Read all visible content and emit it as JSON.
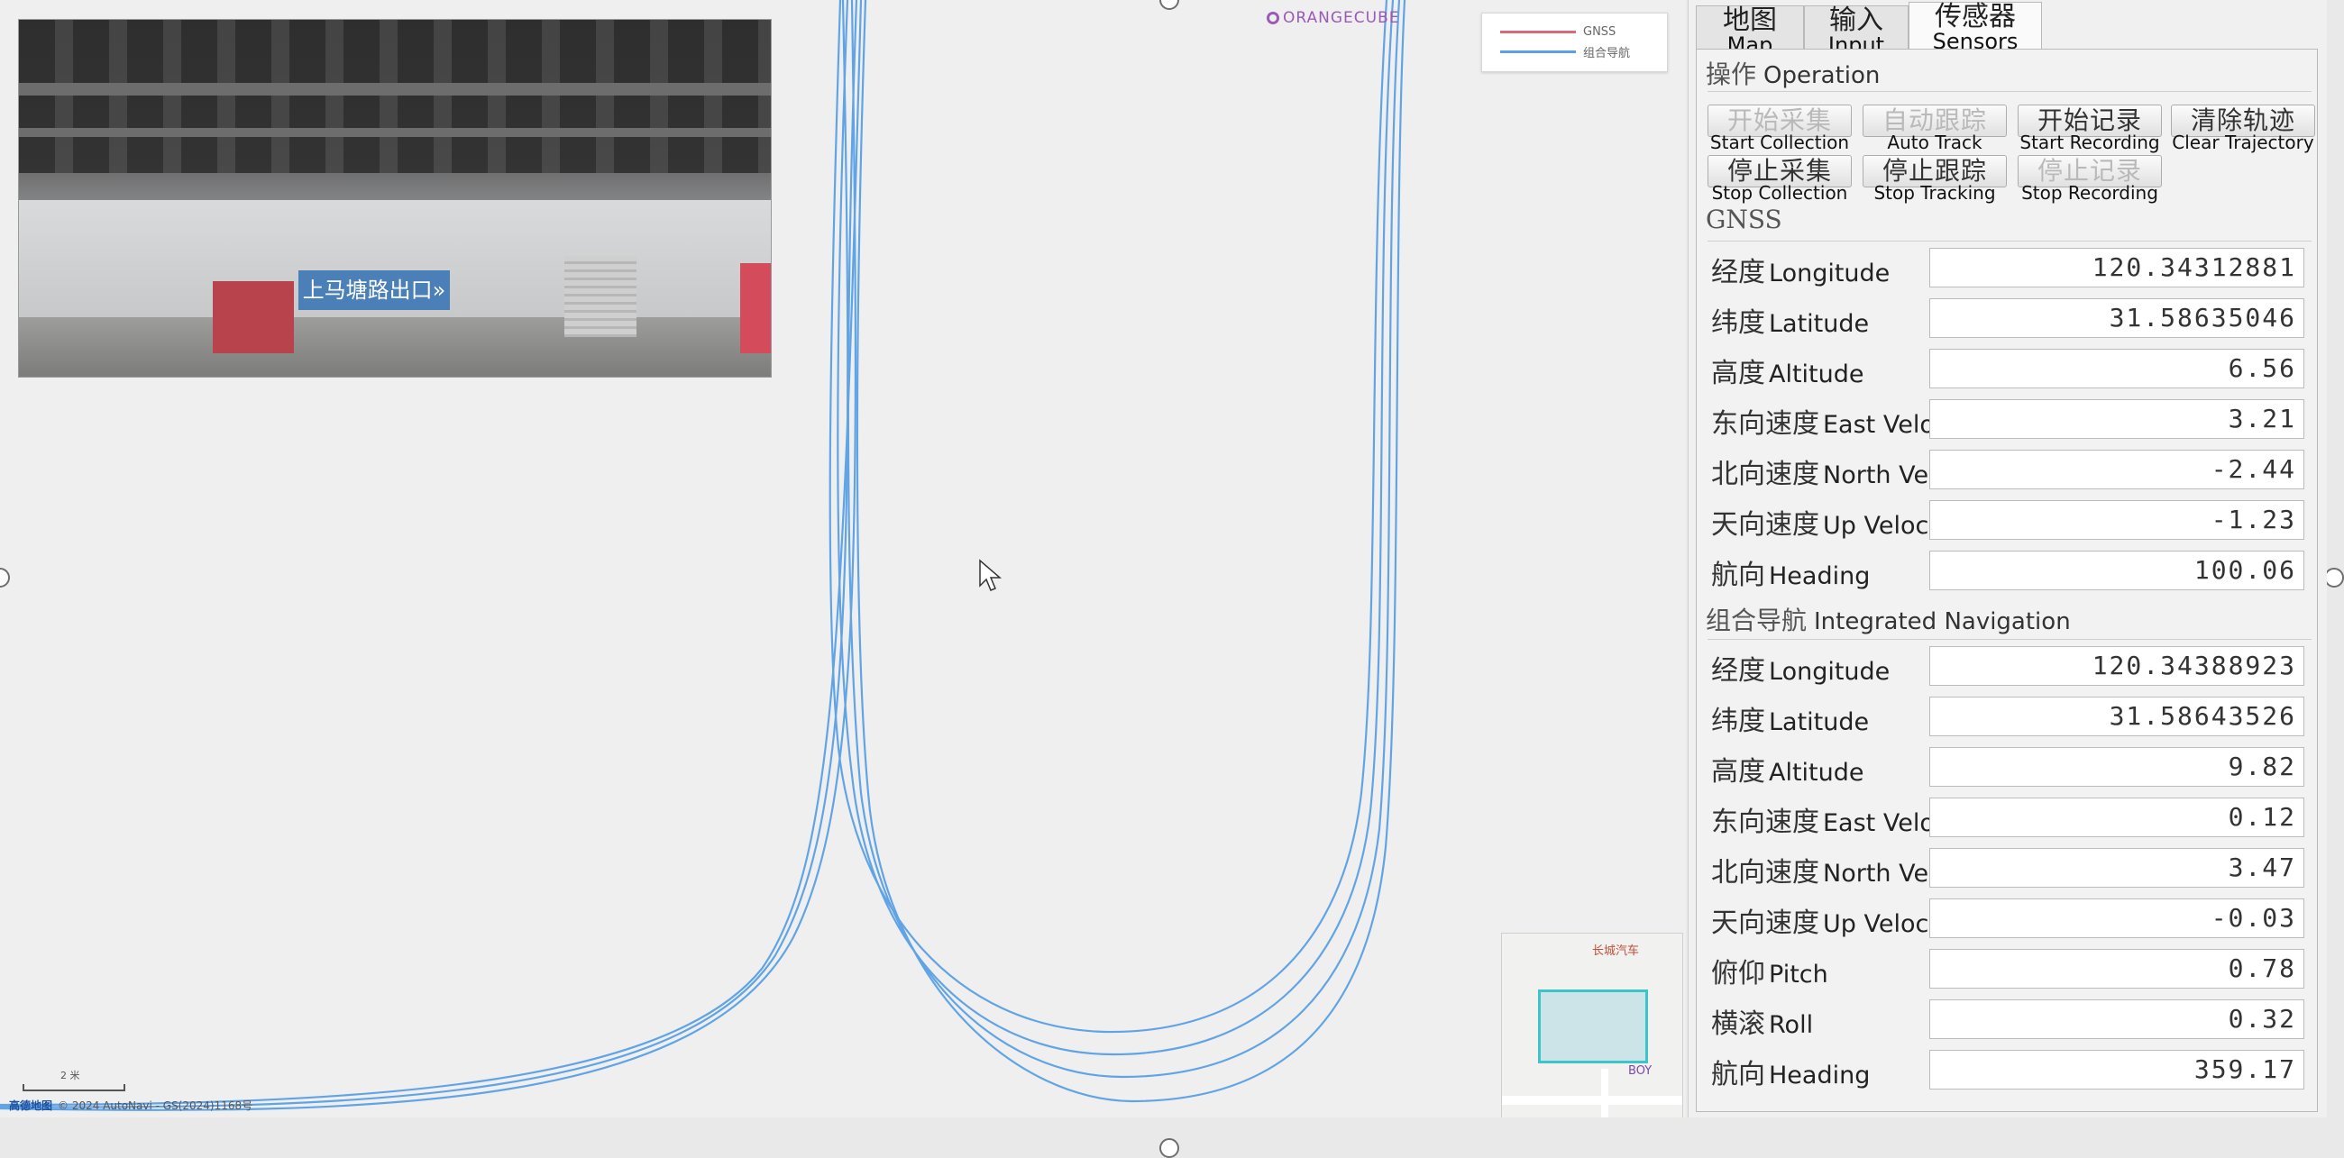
{
  "map": {
    "poi_top": "ORANGECUBE",
    "legend": [
      {
        "label": "GNSS",
        "color": "#d46a7a"
      },
      {
        "label": "组合导航",
        "color": "#5aa0e6"
      }
    ],
    "scale_label": "2 米",
    "logo": "高德地图",
    "copyright": "© 2024 AutoNavi - GS(2024)1168号",
    "camera_sign": "上马塘路出口»",
    "minimap_labels": [
      "长城汽车",
      "BOY"
    ],
    "track_color": "#5aa0e6"
  },
  "tabs": [
    {
      "cn": "地图",
      "en": "Map"
    },
    {
      "cn": "输入",
      "en": "Input"
    },
    {
      "cn": "传感器",
      "en": "Sensors"
    }
  ],
  "operation": {
    "title_cn": "操作",
    "title_en": "Operation",
    "buttons": [
      {
        "cn": "开始采集",
        "en": "Start Collection"
      },
      {
        "cn": "自动跟踪",
        "en": "Auto Track"
      },
      {
        "cn": "开始记录",
        "en": "Start Recording"
      },
      {
        "cn": "清除轨迹",
        "en": "Clear Trajectory"
      },
      {
        "cn": "停止采集",
        "en": "Stop Collection"
      },
      {
        "cn": "停止跟踪",
        "en": "Stop Tracking"
      },
      {
        "cn": "停止记录",
        "en": "Stop Recording"
      }
    ]
  },
  "gnss": {
    "title": "GNSS",
    "rows": [
      {
        "cn": "经度",
        "en": "Longitude",
        "value": "120.34312881"
      },
      {
        "cn": "纬度",
        "en": "Latitude",
        "value": "31.58635046"
      },
      {
        "cn": "高度",
        "en": "Altitude",
        "value": "6.56"
      },
      {
        "cn": "东向速度",
        "en": "East Velocity",
        "value": "3.21"
      },
      {
        "cn": "北向速度",
        "en": "North Velocity",
        "value": "-2.44"
      },
      {
        "cn": "天向速度",
        "en": "Up Velocity",
        "value": "-1.23"
      },
      {
        "cn": "航向",
        "en": "Heading",
        "value": "100.06"
      }
    ]
  },
  "ins": {
    "title_cn": "组合导航",
    "title_en": "Integrated Navigation",
    "rows": [
      {
        "cn": "经度",
        "en": "Longitude",
        "value": "120.34388923"
      },
      {
        "cn": "纬度",
        "en": "Latitude",
        "value": "31.58643526"
      },
      {
        "cn": "高度",
        "en": "Altitude",
        "value": "9.82"
      },
      {
        "cn": "东向速度",
        "en": "East Velocity",
        "value": "0.12"
      },
      {
        "cn": "北向速度",
        "en": "North Velocity",
        "value": "3.47"
      },
      {
        "cn": "天向速度",
        "en": "Up Velocity",
        "value": "-0.03"
      },
      {
        "cn": "俯仰",
        "en": "Pitch",
        "value": "0.78"
      },
      {
        "cn": "横滚",
        "en": "Roll",
        "value": "0.32"
      },
      {
        "cn": "航向",
        "en": "Heading",
        "value": "359.17"
      }
    ]
  }
}
